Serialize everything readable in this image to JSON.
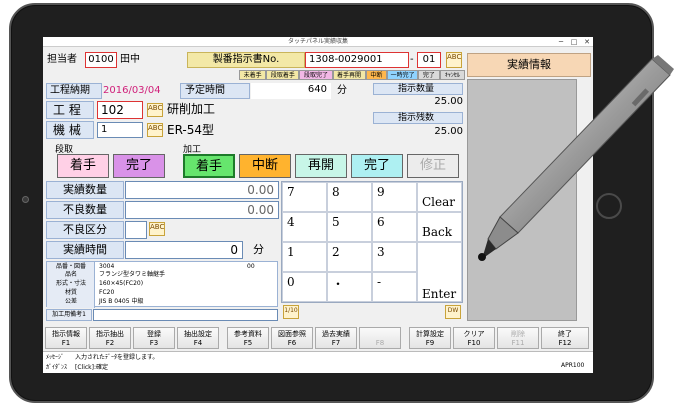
{
  "window": {
    "title": "タッチパネル実績収集",
    "min": "─",
    "max": "□",
    "close": "✕"
  },
  "header": {
    "tantou_label": "担当者",
    "tantou_code": "0100",
    "tantou_name": "田中",
    "order_label": "製番指示書No.",
    "order_no": "1308-0029001",
    "order_sep": "-",
    "order_sub": "01",
    "abc": "ABC"
  },
  "status_tags": [
    "未着手",
    "段取着手",
    "段取完了",
    "着手再開",
    "中断",
    "一時完了",
    "完了",
    "ｷｬﾝｾﾙ"
  ],
  "status_colors": [
    "#f3e8a6",
    "#f3e8a6",
    "#f2b8e6",
    "#f3e8a6",
    "#ffb74d",
    "#8fd3ff",
    "#d9d9d9",
    "#d9d9d9"
  ],
  "side_title": "実績情報",
  "form": {
    "deadline_label": "工程納期",
    "deadline": "2016/03/04",
    "plan_label": "予定時間",
    "plan_value": "640",
    "plan_unit": "分",
    "process_label": "工 程",
    "process_code": "102",
    "process_name": "研削加工",
    "machine_label": "機 械",
    "machine_code": "1",
    "machine_name": "ER-54型",
    "qty_label": "指示数量",
    "qty_value": "25.00",
    "remain_label": "指示残数",
    "remain_value": "25.00"
  },
  "setup": {
    "label": "段取",
    "start": "着手",
    "done": "完了"
  },
  "work": {
    "label": "加工",
    "start": "着手",
    "pause": "中断",
    "resume": "再開",
    "done": "完了",
    "fix": "修正"
  },
  "result": {
    "qty_label": "実績数量",
    "qty_value": "0.00",
    "defect_label": "不良数量",
    "defect_value": "0.00",
    "defect_cat_label": "不良区分",
    "time_label": "実績時間",
    "time_value": "0",
    "time_unit": "分"
  },
  "item_info": {
    "rows": [
      {
        "k": "品番・図番",
        "v": "3004",
        "extra": "00"
      },
      {
        "k": "品名",
        "v": "フランジ型タワミ軸継手",
        "extra": ""
      },
      {
        "k": "形式・寸法",
        "v": "160×45(FC20)",
        "extra": ""
      },
      {
        "k": "材質",
        "v": "FC20",
        "extra": ""
      },
      {
        "k": "公差",
        "v": "JIS B 0405 中級",
        "extra": ""
      }
    ],
    "memo_label": "加工用備考1"
  },
  "keypad": {
    "keys": [
      "7",
      "8",
      "9",
      "4",
      "5",
      "6",
      "1",
      "2",
      "3",
      "0",
      "・",
      "-"
    ],
    "clear": "Clear",
    "back": "Back",
    "enter": "Enter"
  },
  "corner_icons": {
    "left": "1/10",
    "right": "DW"
  },
  "fkeys": [
    {
      "name": "指示情報",
      "key": "F1"
    },
    {
      "name": "指示抽出",
      "key": "F2"
    },
    {
      "name": "登録",
      "key": "F3"
    },
    {
      "name": "抽出設定",
      "key": "F4"
    },
    {
      "name": "参考資料",
      "key": "F5"
    },
    {
      "name": "図面参照",
      "key": "F6"
    },
    {
      "name": "過去実績",
      "key": "F7"
    },
    {
      "name": "",
      "key": "F8"
    },
    {
      "name": "計算設定",
      "key": "F9"
    },
    {
      "name": "クリア",
      "key": "F10"
    },
    {
      "name": "削除",
      "key": "F11"
    },
    {
      "name": "終了",
      "key": "F12"
    }
  ],
  "statusbar": {
    "msg_label": "ﾒｯｾｰｼﾞ",
    "msg": "入力されたﾃﾞｰﾀを登録します。",
    "guide_label": "ｶﾞｲﾀﾞﾝｽ",
    "guide": "[Click]:確定",
    "version": "APR100"
  }
}
